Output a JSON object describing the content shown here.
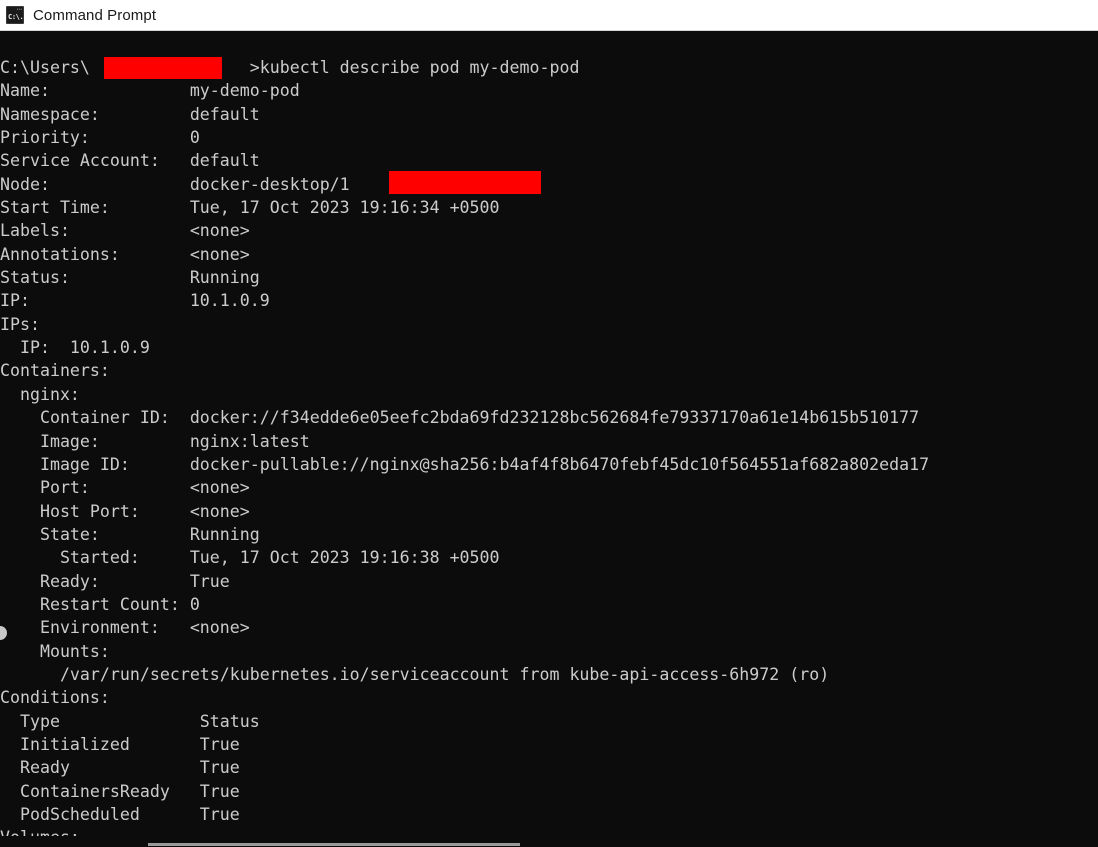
{
  "window": {
    "title": "Command Prompt",
    "icon": "command-prompt-icon",
    "icon_glyph": "C:\\.",
    "background_color": "#0c0c0c",
    "text_color": "#cccccc",
    "redaction_color": "#fe0000"
  },
  "terminal": {
    "prompt_prefix": "C:\\Users\\",
    "prompt_suffix": ">",
    "command": "kubectl describe pod my-demo-pod",
    "lines": [
      "C:\\Users\\                >kubectl describe pod my-demo-pod",
      "Name:              my-demo-pod",
      "Namespace:         default",
      "Priority:          0",
      "Service Account:   default",
      "Node:              docker-desktop/1",
      "Start Time:        Tue, 17 Oct 2023 19:16:34 +0500",
      "Labels:            <none>",
      "Annotations:       <none>",
      "Status:            Running",
      "IP:                10.1.0.9",
      "IPs:",
      "  IP:  10.1.0.9",
      "Containers:",
      "  nginx:",
      "    Container ID:  docker://f34edde6e05eefc2bda69fd232128bc562684fe79337170a61e14b615b510177",
      "    Image:         nginx:latest",
      "    Image ID:      docker-pullable://nginx@sha256:b4af4f8b6470febf45dc10f564551af682a802eda17",
      "    Port:          <none>",
      "    Host Port:     <none>",
      "    State:         Running",
      "      Started:     Tue, 17 Oct 2023 19:16:38 +0500",
      "    Ready:         True",
      "    Restart Count: 0",
      "    Environment:   <none>",
      "    Mounts:",
      "      /var/run/secrets/kubernetes.io/serviceaccount from kube-api-access-6h972 (ro)",
      "Conditions:",
      "  Type              Status",
      "  Initialized       True",
      "  Ready             True",
      "  ContainersReady   True",
      "  PodScheduled      True",
      "Volumes:"
    ],
    "fields": {
      "name": "my-demo-pod",
      "namespace": "default",
      "priority": "0",
      "service_account": "default",
      "node": "docker-desktop/1",
      "start_time": "Tue, 17 Oct 2023 19:16:34 +0500",
      "labels": "<none>",
      "annotations": "<none>",
      "status": "Running",
      "ip": "10.1.0.9",
      "ips": [
        "10.1.0.9"
      ]
    },
    "container": {
      "name": "nginx",
      "container_id": "docker://f34edde6e05eefc2bda69fd232128bc562684fe79337170a61e14b615b510177",
      "image": "nginx:latest",
      "image_id": "docker-pullable://nginx@sha256:b4af4f8b6470febf45dc10f564551af682a802eda17",
      "port": "<none>",
      "host_port": "<none>",
      "state": "Running",
      "started": "Tue, 17 Oct 2023 19:16:38 +0500",
      "ready": "True",
      "restart_count": "0",
      "environment": "<none>",
      "mounts": [
        "/var/run/secrets/kubernetes.io/serviceaccount from kube-api-access-6h972 (ro)"
      ]
    },
    "conditions": {
      "headers": [
        "Type",
        "Status"
      ],
      "rows": [
        [
          "Initialized",
          "True"
        ],
        [
          "Ready",
          "True"
        ],
        [
          "ContainersReady",
          "True"
        ],
        [
          "PodScheduled",
          "True"
        ]
      ]
    },
    "trailing_section": "Volumes:"
  }
}
